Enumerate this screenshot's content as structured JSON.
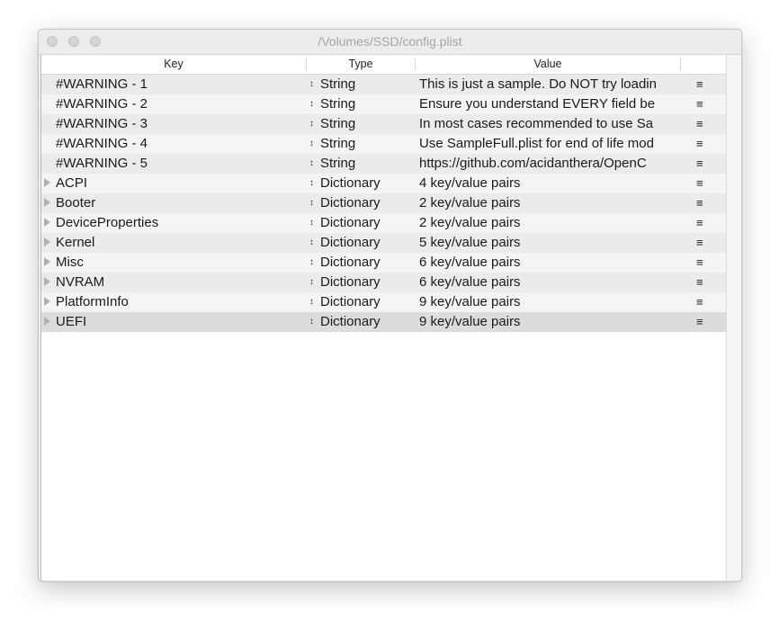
{
  "window": {
    "title": "/Volumes/SSD/config.plist"
  },
  "columns": {
    "key": "Key",
    "type": "Type",
    "value": "Value"
  },
  "icons": {
    "type_selector": "↕",
    "row_menu": "≡",
    "disclosure": "disclosure-triangle-icon"
  },
  "rows": [
    {
      "key": "#WARNING - 1",
      "type": "String",
      "value": "This is just a sample. Do NOT try loadin",
      "expandable": false
    },
    {
      "key": "#WARNING - 2",
      "type": "String",
      "value": "Ensure you understand EVERY field be",
      "expandable": false
    },
    {
      "key": "#WARNING - 3",
      "type": "String",
      "value": "In most cases recommended to use Sa",
      "expandable": false
    },
    {
      "key": "#WARNING - 4",
      "type": "String",
      "value": "Use SampleFull.plist for end of life mod",
      "expandable": false
    },
    {
      "key": "#WARNING - 5",
      "type": "String",
      "value": "https://github.com/acidanthera/OpenC",
      "expandable": false
    },
    {
      "key": "ACPI",
      "type": "Dictionary",
      "value": "4 key/value pairs",
      "expandable": true
    },
    {
      "key": "Booter",
      "type": "Dictionary",
      "value": "2 key/value pairs",
      "expandable": true
    },
    {
      "key": "DeviceProperties",
      "type": "Dictionary",
      "value": "2 key/value pairs",
      "expandable": true
    },
    {
      "key": "Kernel",
      "type": "Dictionary",
      "value": "5 key/value pairs",
      "expandable": true
    },
    {
      "key": "Misc",
      "type": "Dictionary",
      "value": "6 key/value pairs",
      "expandable": true
    },
    {
      "key": "NVRAM",
      "type": "Dictionary",
      "value": "6 key/value pairs",
      "expandable": true
    },
    {
      "key": "PlatformInfo",
      "type": "Dictionary",
      "value": "9 key/value pairs",
      "expandable": true
    },
    {
      "key": "UEFI",
      "type": "Dictionary",
      "value": "9 key/value pairs",
      "expandable": true,
      "selected": true
    }
  ]
}
